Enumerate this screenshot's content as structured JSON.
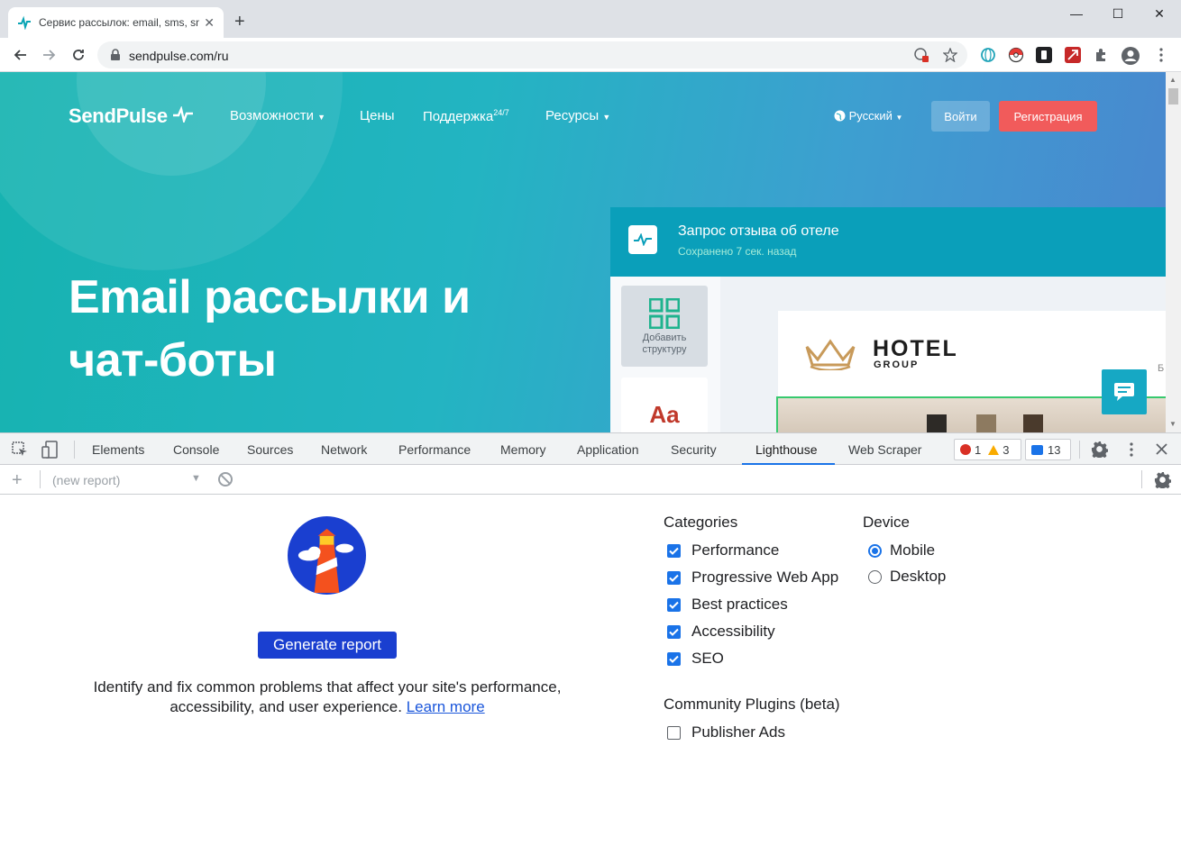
{
  "browser": {
    "tab_title": "Сервис рассылок: email, sms, sms",
    "tab_close": "✕",
    "new_tab": "+",
    "url": "sendpulse.com/ru",
    "window_controls": [
      "—",
      "☐",
      "✕"
    ]
  },
  "site": {
    "logo": "SendPulse",
    "nav": [
      {
        "label": "Возможности",
        "dropdown": true
      },
      {
        "label": "Цены",
        "dropdown": false
      },
      {
        "label": "Поддержка",
        "sup": "24/7",
        "dropdown": false
      },
      {
        "label": "Ресурсы",
        "dropdown": true
      }
    ],
    "language": "Русский",
    "login_label": "Войти",
    "register_label": "Регистрация",
    "hero_line1": "Email рассылки и",
    "hero_line2": "чат-боты",
    "mock": {
      "title": "Запрос отзыва об отеле",
      "subtitle": "Сохранено 7 сек. назад",
      "tile_label_1": "Добавить",
      "tile_label_2": "структуру",
      "aa_label": "Aa",
      "hotel_name": "HOTEL",
      "hotel_sub": "GROUP",
      "edge_letter": "Б"
    }
  },
  "devtools": {
    "tabs": [
      {
        "label": "Elements"
      },
      {
        "label": "Console"
      },
      {
        "label": "Sources"
      },
      {
        "label": "Network"
      },
      {
        "label": "Performance"
      },
      {
        "label": "Memory"
      },
      {
        "label": "Application"
      },
      {
        "label": "Security"
      },
      {
        "label": "Lighthouse",
        "active": true
      },
      {
        "label": "Web Scraper"
      }
    ],
    "errors": "1",
    "warnings": "3",
    "messages": "13",
    "report_select": "(new report)",
    "add_label": "+"
  },
  "lighthouse": {
    "generate_label": "Generate report",
    "description": "Identify and fix common problems that affect your site's performance, accessibility, and user experience.",
    "learn_more": "Learn more",
    "categories_title": "Categories",
    "categories": [
      {
        "label": "Performance",
        "checked": true
      },
      {
        "label": "Progressive Web App",
        "checked": true
      },
      {
        "label": "Best practices",
        "checked": true
      },
      {
        "label": "Accessibility",
        "checked": true
      },
      {
        "label": "SEO",
        "checked": true
      }
    ],
    "device_title": "Device",
    "devices": [
      {
        "label": "Mobile",
        "selected": true
      },
      {
        "label": "Desktop",
        "selected": false
      }
    ],
    "plugins_title": "Community Plugins (beta)",
    "plugins": [
      {
        "label": "Publisher Ads",
        "checked": false
      }
    ]
  },
  "colors": {
    "accent": "#1a73e8",
    "generate_button": "#1a3fd0",
    "register_button": "#f15b5b"
  }
}
